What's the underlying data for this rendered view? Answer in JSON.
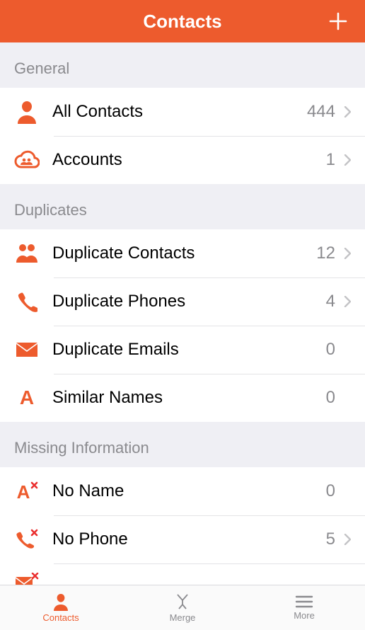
{
  "colors": {
    "accent": "#ed5b2d",
    "muted": "#8a8a8e",
    "red": "#ea2e2e"
  },
  "header": {
    "title": "Contacts",
    "add_icon": "plus-icon"
  },
  "sections": [
    {
      "title": "General",
      "rows": [
        {
          "icon": "person-icon",
          "label": "All Contacts",
          "count": "444",
          "chevron": true
        },
        {
          "icon": "cloud-people-icon",
          "label": "Accounts",
          "count": "1",
          "chevron": true
        }
      ]
    },
    {
      "title": "Duplicates",
      "rows": [
        {
          "icon": "two-people-icon",
          "label": "Duplicate Contacts",
          "count": "12",
          "chevron": true
        },
        {
          "icon": "phone-icon",
          "label": "Duplicate Phones",
          "count": "4",
          "chevron": true
        },
        {
          "icon": "envelope-icon",
          "label": "Duplicate Emails",
          "count": "0",
          "chevron": false
        },
        {
          "icon": "letter-a-icon",
          "label": "Similar Names",
          "count": "0",
          "chevron": false
        }
      ]
    },
    {
      "title": "Missing Information",
      "rows": [
        {
          "icon": "letter-a-x-icon",
          "label": "No Name",
          "count": "0",
          "chevron": false
        },
        {
          "icon": "phone-x-icon",
          "label": "No Phone",
          "count": "5",
          "chevron": true
        },
        {
          "icon": "envelope-x-icon",
          "label": "",
          "count": "",
          "chevron": false
        }
      ]
    }
  ],
  "tabs": {
    "contacts": "Contacts",
    "merge": "Merge",
    "more": "More"
  }
}
